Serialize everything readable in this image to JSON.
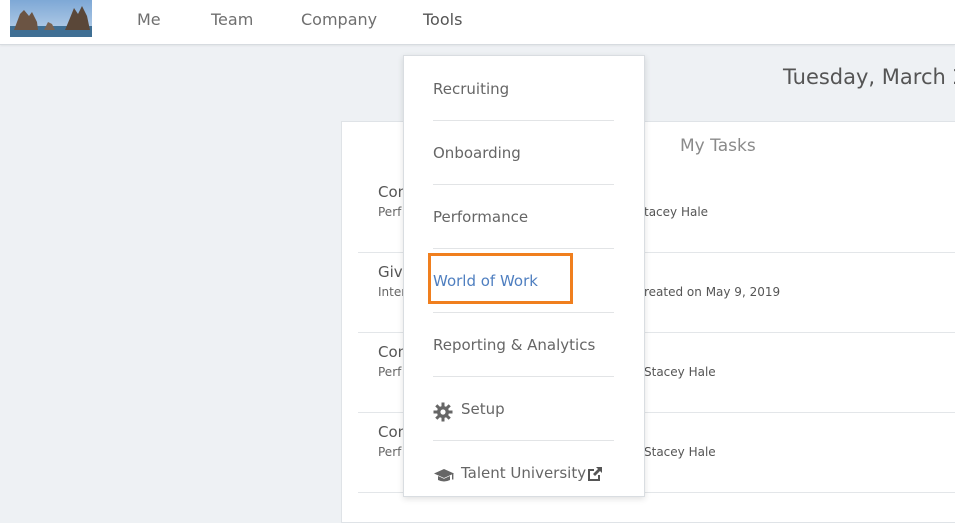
{
  "nav": {
    "items": [
      "Me",
      "Team",
      "Company",
      "Tools"
    ]
  },
  "header": {
    "date": "Tuesday, March 2"
  },
  "tasks_panel": {
    "title": "My Tasks",
    "tasks": [
      {
        "title": "Con",
        "subtitle": "Perf",
        "meta": "tacey Hale"
      },
      {
        "title": "Give",
        "subtitle": "Inter",
        "meta": "reated on May 9, 2019"
      },
      {
        "title": "Con",
        "subtitle": "Perf",
        "meta": "Stacey Hale"
      },
      {
        "title": "Con",
        "subtitle": "Perf",
        "meta": "Stacey Hale"
      }
    ]
  },
  "tools_menu": {
    "items": [
      {
        "label": "Recruiting"
      },
      {
        "label": "Onboarding"
      },
      {
        "label": "Performance"
      },
      {
        "label": "World of Work",
        "active": true
      },
      {
        "label": "Reporting & Analytics"
      },
      {
        "label": "Setup",
        "icon": "gear-icon"
      },
      {
        "label": "Talent University",
        "icon": "graduation-cap-icon",
        "trailing_icon": "external-link-icon"
      }
    ]
  },
  "colors": {
    "accent_link": "#4f7fc0",
    "highlight_border": "#f07f1e",
    "page_bg": "#eef1f4"
  }
}
